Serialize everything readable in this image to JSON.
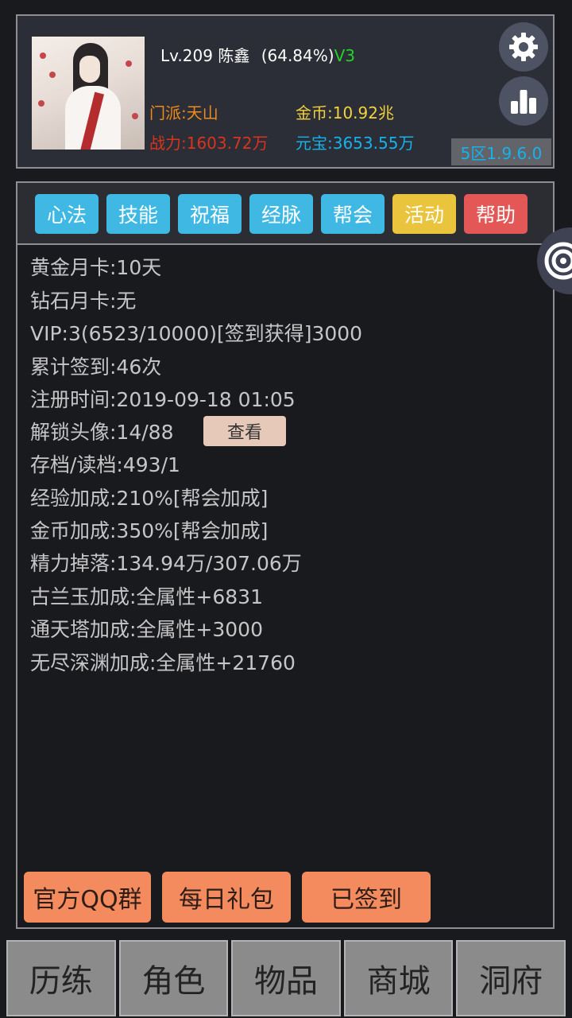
{
  "player": {
    "level": "Lv.209",
    "name": "陈鑫",
    "exp_pct": "(64.84%)",
    "vip_tag": "V3",
    "sect": "门派:天山",
    "gold": "金币:10.92兆",
    "power": "战力:1603.72万",
    "yuanbao": "元宝:3653.55万",
    "server_version": "5区1.9.6.0"
  },
  "tabs": [
    {
      "label": "心法",
      "color": "#3fb9e3"
    },
    {
      "label": "技能",
      "color": "#3fb9e3"
    },
    {
      "label": "祝福",
      "color": "#3fb9e3"
    },
    {
      "label": "经脉",
      "color": "#3fb9e3"
    },
    {
      "label": "帮会",
      "color": "#3fb9e3"
    },
    {
      "label": "活动",
      "color": "#eac43d"
    },
    {
      "label": "帮助",
      "color": "#e35757"
    }
  ],
  "info": [
    "黄金月卡:10天",
    "钻石月卡:无",
    "VIP:3(6523/10000)[签到获得]3000",
    "累计签到:46次",
    "注册时间:2019-09-18 01:05",
    "解锁头像:14/88",
    "存档/读档:493/1",
    "经验加成:210%[帮会加成]",
    "金币加成:350%[帮会加成]",
    "精力掉落:134.94万/307.06万",
    "古兰玉加成:全属性+6831",
    "通天塔加成:全属性+3000",
    "无尽深渊加成:全属性+21760"
  ],
  "view_button": "查看",
  "actions": {
    "qq_group": "官方QQ群",
    "daily_gift": "每日礼包",
    "signed_in": "已签到"
  },
  "bottom_nav": [
    "历练",
    "角色",
    "物品",
    "商城",
    "洞府"
  ],
  "icons": {
    "settings": "gear-icon",
    "ranking": "bar-chart-icon",
    "side": "spiral-icon"
  },
  "colors": {
    "level_text": "#ffffff",
    "vip_green": "#22d322",
    "sect_orange": "#f08a1a",
    "gold_yellow": "#f2d23c",
    "power_red": "#d8341e",
    "yuanbao_blue": "#16b2ec"
  }
}
